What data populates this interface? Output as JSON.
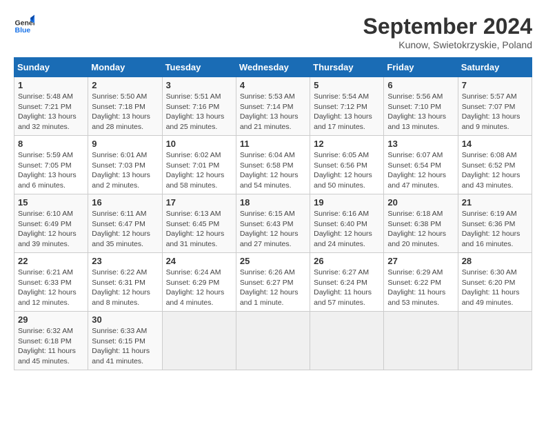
{
  "logo": {
    "line1": "General",
    "line2": "Blue"
  },
  "title": "September 2024",
  "location": "Kunow, Swietokrzyskie, Poland",
  "days_header": [
    "Sunday",
    "Monday",
    "Tuesday",
    "Wednesday",
    "Thursday",
    "Friday",
    "Saturday"
  ],
  "weeks": [
    [
      {
        "day": "1",
        "info": "Sunrise: 5:48 AM\nSunset: 7:21 PM\nDaylight: 13 hours\nand 32 minutes."
      },
      {
        "day": "2",
        "info": "Sunrise: 5:50 AM\nSunset: 7:18 PM\nDaylight: 13 hours\nand 28 minutes."
      },
      {
        "day": "3",
        "info": "Sunrise: 5:51 AM\nSunset: 7:16 PM\nDaylight: 13 hours\nand 25 minutes."
      },
      {
        "day": "4",
        "info": "Sunrise: 5:53 AM\nSunset: 7:14 PM\nDaylight: 13 hours\nand 21 minutes."
      },
      {
        "day": "5",
        "info": "Sunrise: 5:54 AM\nSunset: 7:12 PM\nDaylight: 13 hours\nand 17 minutes."
      },
      {
        "day": "6",
        "info": "Sunrise: 5:56 AM\nSunset: 7:10 PM\nDaylight: 13 hours\nand 13 minutes."
      },
      {
        "day": "7",
        "info": "Sunrise: 5:57 AM\nSunset: 7:07 PM\nDaylight: 13 hours\nand 9 minutes."
      }
    ],
    [
      {
        "day": "8",
        "info": "Sunrise: 5:59 AM\nSunset: 7:05 PM\nDaylight: 13 hours\nand 6 minutes."
      },
      {
        "day": "9",
        "info": "Sunrise: 6:01 AM\nSunset: 7:03 PM\nDaylight: 13 hours\nand 2 minutes."
      },
      {
        "day": "10",
        "info": "Sunrise: 6:02 AM\nSunset: 7:01 PM\nDaylight: 12 hours\nand 58 minutes."
      },
      {
        "day": "11",
        "info": "Sunrise: 6:04 AM\nSunset: 6:58 PM\nDaylight: 12 hours\nand 54 minutes."
      },
      {
        "day": "12",
        "info": "Sunrise: 6:05 AM\nSunset: 6:56 PM\nDaylight: 12 hours\nand 50 minutes."
      },
      {
        "day": "13",
        "info": "Sunrise: 6:07 AM\nSunset: 6:54 PM\nDaylight: 12 hours\nand 47 minutes."
      },
      {
        "day": "14",
        "info": "Sunrise: 6:08 AM\nSunset: 6:52 PM\nDaylight: 12 hours\nand 43 minutes."
      }
    ],
    [
      {
        "day": "15",
        "info": "Sunrise: 6:10 AM\nSunset: 6:49 PM\nDaylight: 12 hours\nand 39 minutes."
      },
      {
        "day": "16",
        "info": "Sunrise: 6:11 AM\nSunset: 6:47 PM\nDaylight: 12 hours\nand 35 minutes."
      },
      {
        "day": "17",
        "info": "Sunrise: 6:13 AM\nSunset: 6:45 PM\nDaylight: 12 hours\nand 31 minutes."
      },
      {
        "day": "18",
        "info": "Sunrise: 6:15 AM\nSunset: 6:43 PM\nDaylight: 12 hours\nand 27 minutes."
      },
      {
        "day": "19",
        "info": "Sunrise: 6:16 AM\nSunset: 6:40 PM\nDaylight: 12 hours\nand 24 minutes."
      },
      {
        "day": "20",
        "info": "Sunrise: 6:18 AM\nSunset: 6:38 PM\nDaylight: 12 hours\nand 20 minutes."
      },
      {
        "day": "21",
        "info": "Sunrise: 6:19 AM\nSunset: 6:36 PM\nDaylight: 12 hours\nand 16 minutes."
      }
    ],
    [
      {
        "day": "22",
        "info": "Sunrise: 6:21 AM\nSunset: 6:33 PM\nDaylight: 12 hours\nand 12 minutes."
      },
      {
        "day": "23",
        "info": "Sunrise: 6:22 AM\nSunset: 6:31 PM\nDaylight: 12 hours\nand 8 minutes."
      },
      {
        "day": "24",
        "info": "Sunrise: 6:24 AM\nSunset: 6:29 PM\nDaylight: 12 hours\nand 4 minutes."
      },
      {
        "day": "25",
        "info": "Sunrise: 6:26 AM\nSunset: 6:27 PM\nDaylight: 12 hours\nand 1 minute."
      },
      {
        "day": "26",
        "info": "Sunrise: 6:27 AM\nSunset: 6:24 PM\nDaylight: 11 hours\nand 57 minutes."
      },
      {
        "day": "27",
        "info": "Sunrise: 6:29 AM\nSunset: 6:22 PM\nDaylight: 11 hours\nand 53 minutes."
      },
      {
        "day": "28",
        "info": "Sunrise: 6:30 AM\nSunset: 6:20 PM\nDaylight: 11 hours\nand 49 minutes."
      }
    ],
    [
      {
        "day": "29",
        "info": "Sunrise: 6:32 AM\nSunset: 6:18 PM\nDaylight: 11 hours\nand 45 minutes."
      },
      {
        "day": "30",
        "info": "Sunrise: 6:33 AM\nSunset: 6:15 PM\nDaylight: 11 hours\nand 41 minutes."
      },
      {
        "day": "",
        "info": ""
      },
      {
        "day": "",
        "info": ""
      },
      {
        "day": "",
        "info": ""
      },
      {
        "day": "",
        "info": ""
      },
      {
        "day": "",
        "info": ""
      }
    ]
  ]
}
